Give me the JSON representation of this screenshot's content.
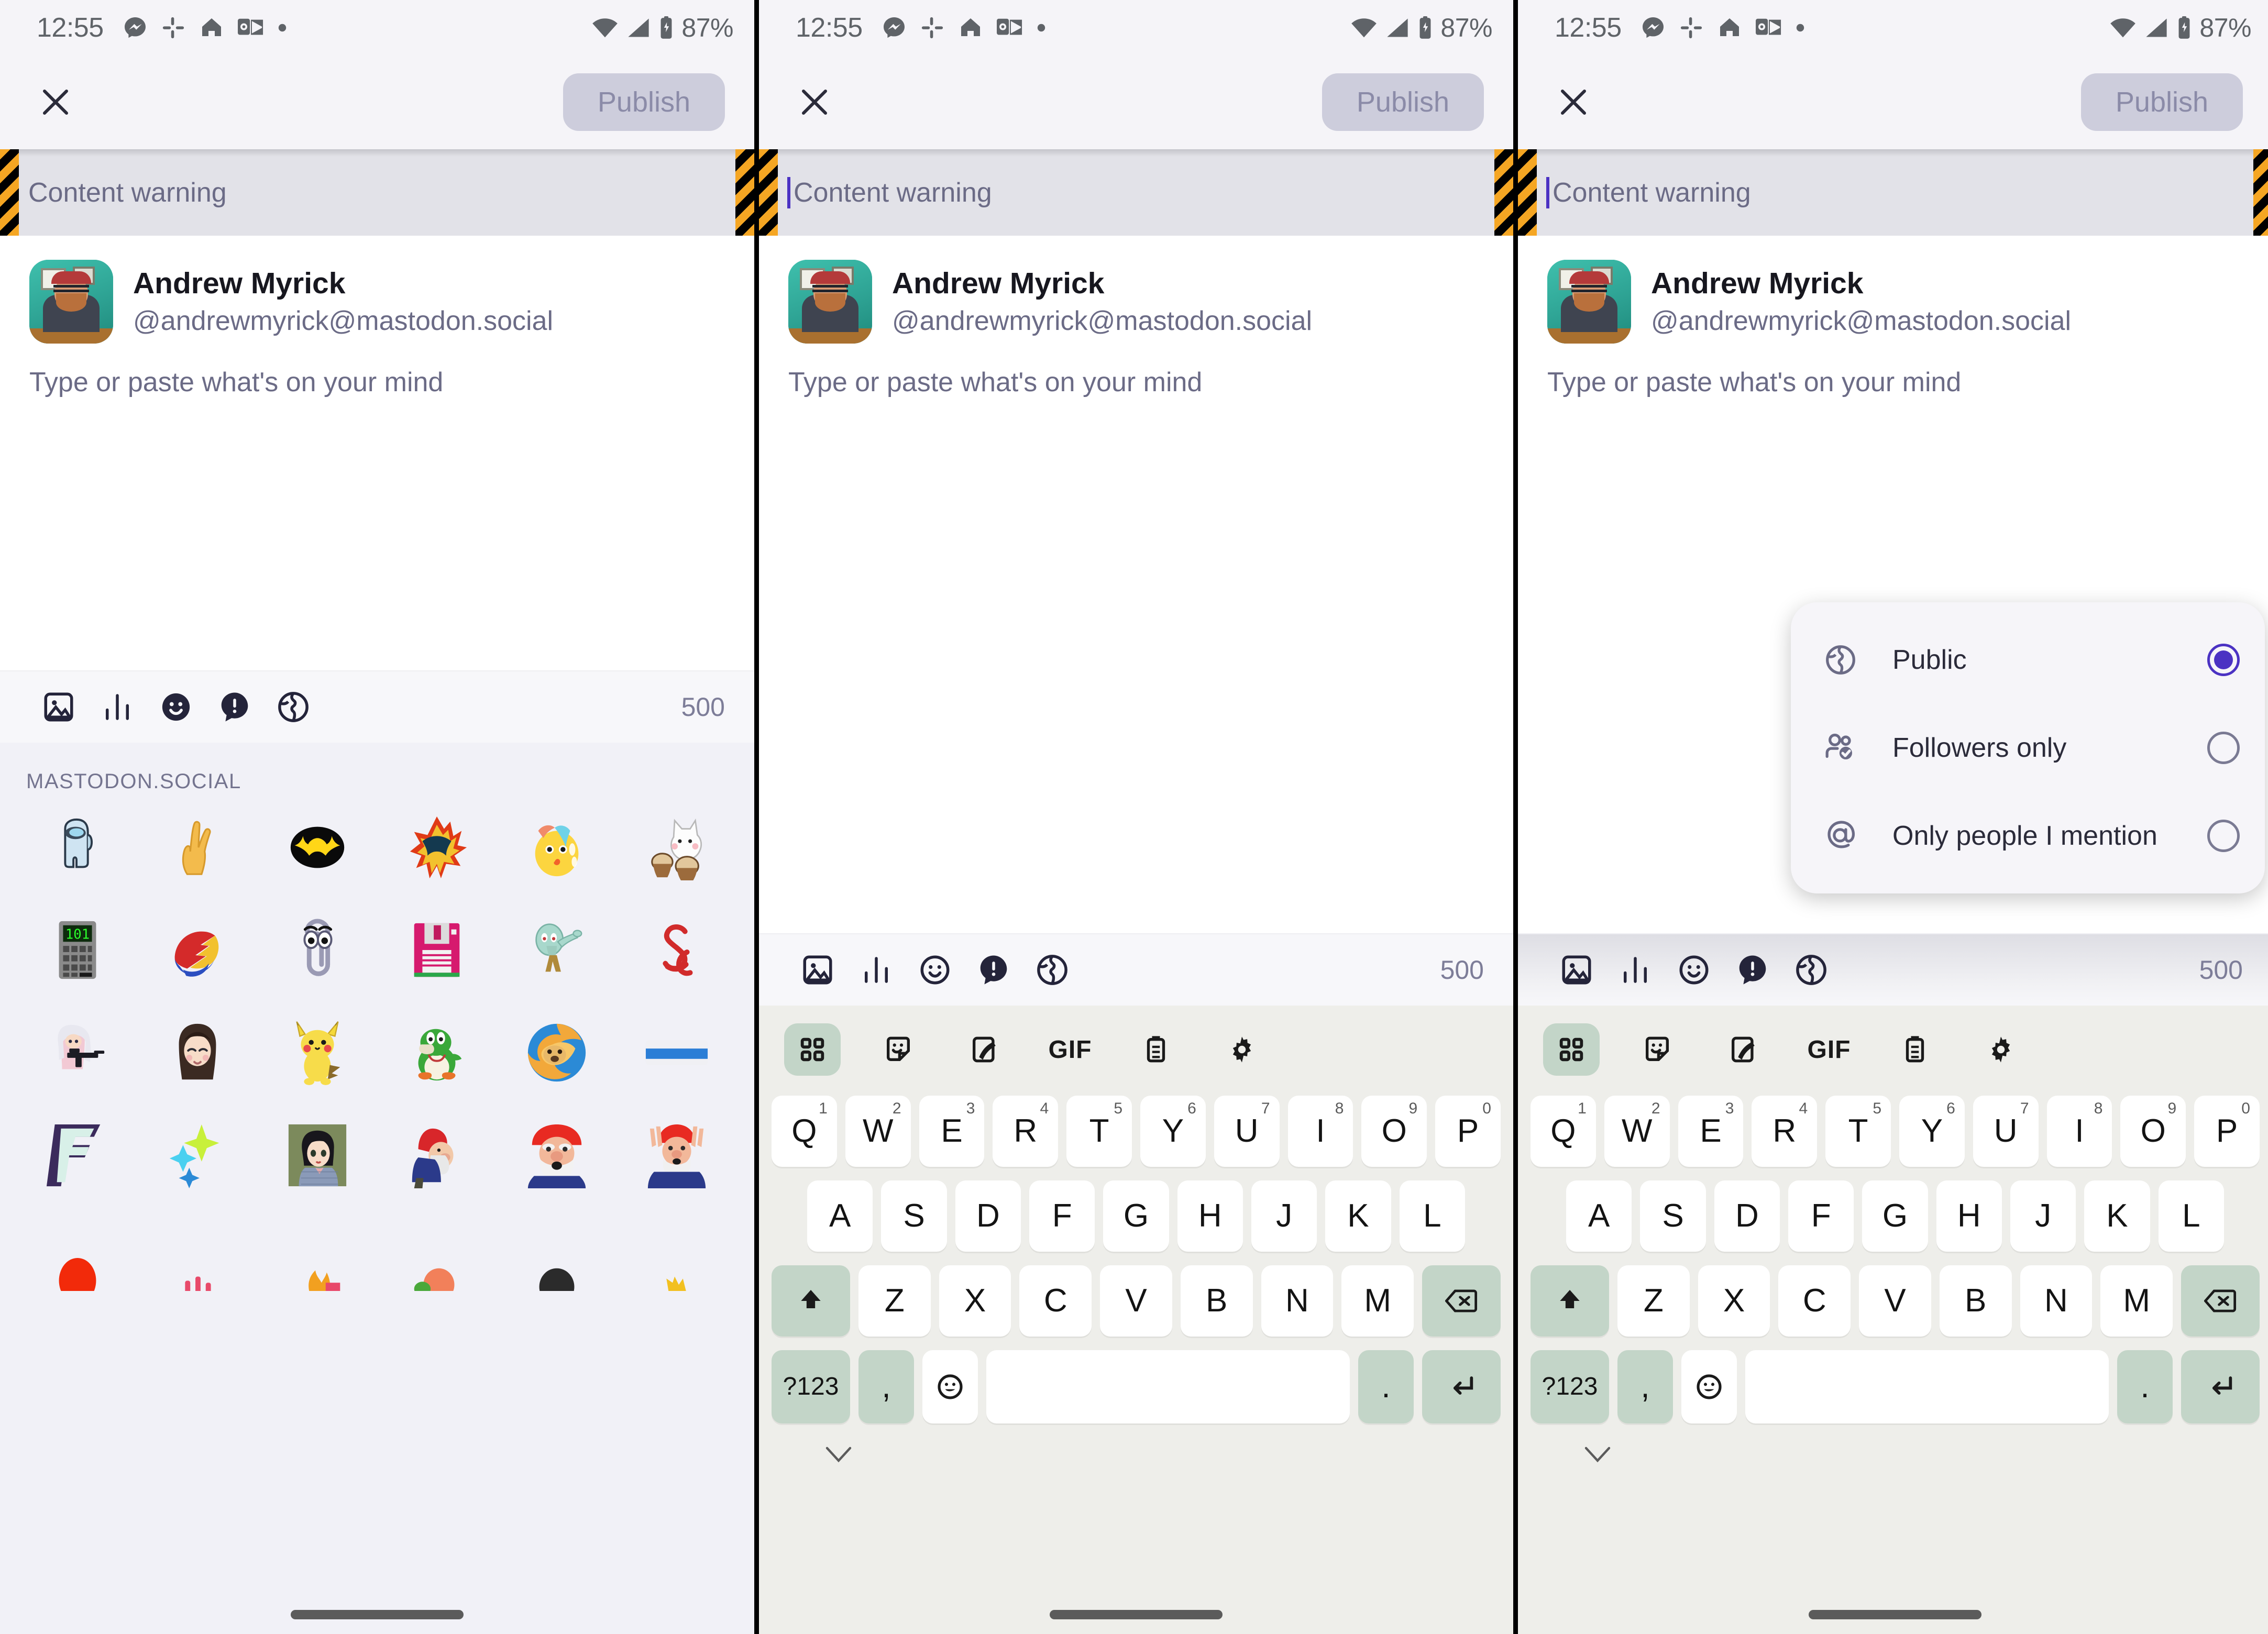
{
  "colors": {
    "accent": "#4b32c3",
    "publish_bg": "#cdcddc",
    "publish_fg": "#8b8ba8",
    "cw_bg": "#e2e2e8",
    "hazard_orange": "#f5a623",
    "keyboard_bg": "#eeeeea",
    "key_mod": "#c3d5c8",
    "panel_bg": "#f5f4f8",
    "muted_text": "#6b6b86"
  },
  "statusbar": {
    "time": "12:55",
    "battery": "87%",
    "notification_icons": [
      "messenger-icon",
      "slack-icon",
      "google-home-icon",
      "outlook-icon",
      "dot-icon"
    ],
    "system_icons": [
      "wifi-icon",
      "signal-icon",
      "battery-icon"
    ]
  },
  "appbar": {
    "close_label": "close-icon",
    "publish_label": "Publish"
  },
  "content_warning": {
    "placeholder": "Content warning",
    "has_caret": true
  },
  "author": {
    "display_name": "Andrew Myrick",
    "handle": "@andrewmyrick@mastodon.social",
    "avatar_alt": "avatar"
  },
  "compose": {
    "placeholder": "Type or paste what's on your mind"
  },
  "toolbar": {
    "items": [
      {
        "name": "add-image-button",
        "icon": "image-icon"
      },
      {
        "name": "add-poll-button",
        "icon": "poll-icon"
      },
      {
        "name": "emoji-button",
        "icon": "emoji-icon"
      },
      {
        "name": "content-warning-button",
        "icon": "warning-icon"
      },
      {
        "name": "visibility-button",
        "icon": "globe-icon"
      }
    ],
    "char_count": "500"
  },
  "emoji_picker": {
    "category_header": "MASTODON.SOCIAL",
    "rows": [
      [
        "among-us",
        "raised-hand",
        "batman-logo",
        "fire-bird",
        "crying-blob",
        "bongo-cat"
      ],
      [
        "calculator",
        "sonic-logo",
        "clippy",
        "floppy-disk",
        "squidward-dab",
        "dnd-ampersand"
      ],
      [
        "anime-girl-gun",
        "anime-sad-girl",
        "pikachu",
        "yoshi",
        "firefox-doge",
        "blue-bar"
      ],
      [
        "fortnite-f",
        "sparkles-blue",
        "anime-boy",
        "gnome-side",
        "gnome-shout",
        "gnome-hands"
      ],
      [
        "red-partial",
        "pink-partial",
        "fire-partial",
        "orange-partial",
        "dark-partial",
        "yellow-partial"
      ]
    ]
  },
  "keyboard": {
    "toolbar_items": [
      {
        "name": "keyboard-grid-button",
        "icon": "grid-icon",
        "active": true
      },
      {
        "name": "sticker-button",
        "icon": "sticker-icon",
        "active": false
      },
      {
        "name": "handwriting-button",
        "icon": "stylus-icon",
        "active": false
      },
      {
        "name": "gif-button",
        "icon": "gif-text",
        "label": "GIF",
        "active": false
      },
      {
        "name": "clipboard-button",
        "icon": "clipboard-icon",
        "active": false
      },
      {
        "name": "keyboard-settings-button",
        "icon": "gear-icon",
        "active": false
      }
    ],
    "row1": [
      {
        "letter": "Q",
        "num": "1"
      },
      {
        "letter": "W",
        "num": "2"
      },
      {
        "letter": "E",
        "num": "3"
      },
      {
        "letter": "R",
        "num": "4"
      },
      {
        "letter": "T",
        "num": "5"
      },
      {
        "letter": "Y",
        "num": "6"
      },
      {
        "letter": "U",
        "num": "7"
      },
      {
        "letter": "I",
        "num": "8"
      },
      {
        "letter": "O",
        "num": "9"
      },
      {
        "letter": "P",
        "num": "0"
      }
    ],
    "row2": [
      "A",
      "S",
      "D",
      "F",
      "G",
      "H",
      "J",
      "K",
      "L"
    ],
    "row3": [
      "Z",
      "X",
      "C",
      "V",
      "B",
      "N",
      "M"
    ],
    "shift_label": "shift-icon",
    "backspace_label": "backspace-icon",
    "symbols_label": "?123",
    "comma_label": ",",
    "emoji_key_label": "emoji-icon",
    "period_label": ".",
    "enter_label": "enter-icon",
    "space_label": "",
    "hide_label": "chevron-down-icon"
  },
  "visibility_menu": {
    "items": [
      {
        "label": "Public",
        "icon": "globe-icon",
        "selected": true
      },
      {
        "label": "Followers only",
        "icon": "followers-icon",
        "selected": false
      },
      {
        "label": "Only people I mention",
        "icon": "at-icon",
        "selected": false
      }
    ]
  }
}
